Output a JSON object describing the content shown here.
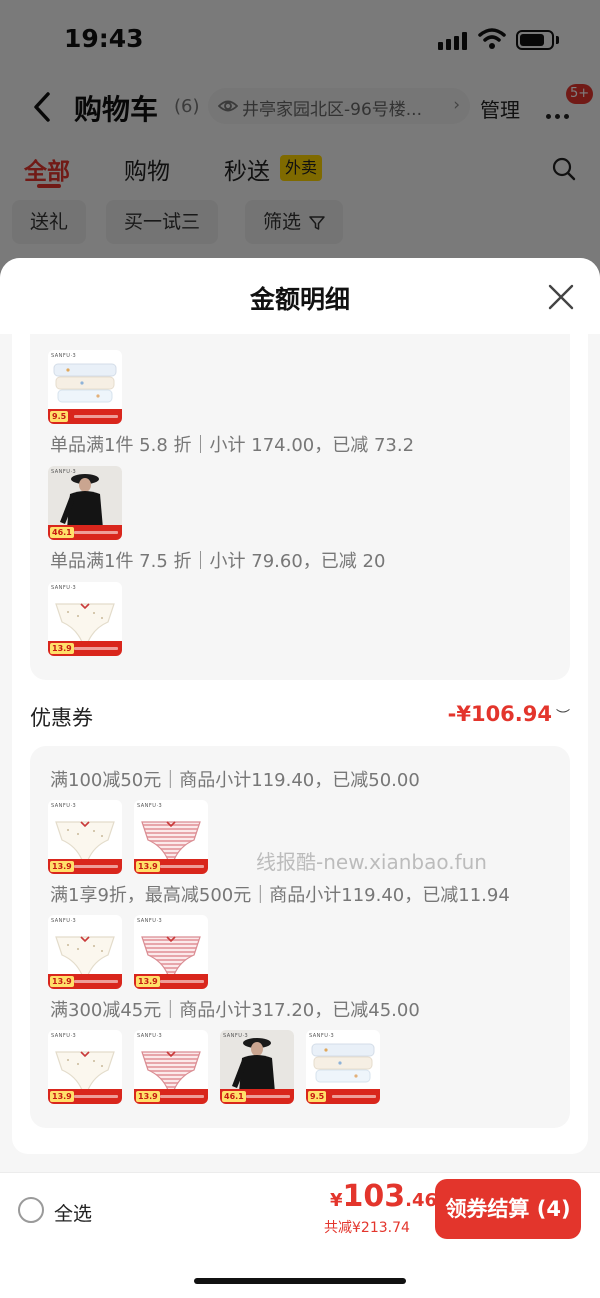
{
  "status_bar": {
    "time": "19:43"
  },
  "nav": {
    "title": "购物车",
    "count": "(6)",
    "address": "井亭家园北区-96号楼...",
    "manage": "管理",
    "badge": "5+"
  },
  "tabs": [
    {
      "label": "全部",
      "active": true
    },
    {
      "label": "购物",
      "active": false
    },
    {
      "label": "秒送",
      "active": false
    }
  ],
  "waimai_badge": "外卖",
  "filters": [
    {
      "label": "送礼"
    },
    {
      "label": "买一试三"
    },
    {
      "label": "筛选"
    }
  ],
  "sheet": {
    "title": "金额明细",
    "discount_rules": [
      {
        "text": "单品满1件 5.8 折｜小计 174.00，已减 73.2"
      },
      {
        "text": "单品满1件 7.5 折｜小计 79.60，已减 20"
      }
    ],
    "coupon": {
      "label": "优惠券",
      "amount": "-¥106.94",
      "rules": [
        {
          "text": "满100减50元｜商品小计119.40，已减50.00"
        },
        {
          "text": "满1享9折，最高减500元｜商品小计119.40，已减11.94"
        },
        {
          "text": "满300减45元｜商品小计317.20，已减45.00"
        }
      ]
    },
    "watermark": "线报酷-new.xianbao.fun"
  },
  "products": {
    "pack": {
      "brand": "SANFU·3",
      "price": "9.5"
    },
    "shirt": {
      "brand": "SANFU·3",
      "price": "46.1"
    },
    "brief_white": {
      "brand": "SANFU·3",
      "price": "13.9"
    },
    "brief_pink": {
      "brand": "SANFU·3",
      "price": "13.9"
    }
  },
  "bottom_bar": {
    "select_all": "全选",
    "currency": "¥",
    "total_int": "103",
    "total_dec": ".46",
    "saved": "共减¥213.74",
    "checkout": "领券结算 (4)"
  },
  "colors": {
    "accent": "#e3352c",
    "waimai": "#ffd400"
  }
}
